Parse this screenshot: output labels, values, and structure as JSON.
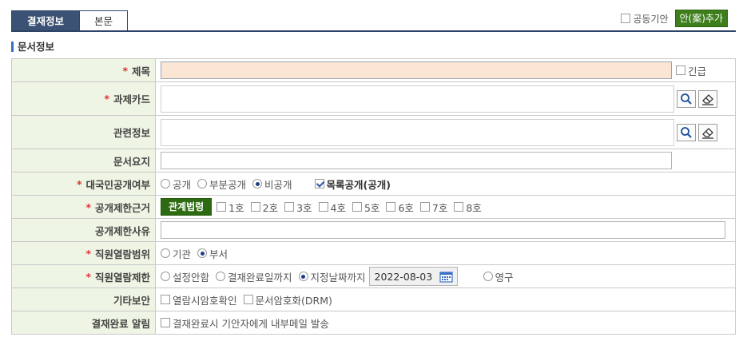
{
  "tabs": {
    "active": "결재정보",
    "inactive": "본문"
  },
  "top_right": {
    "joint_drafter_label": "공동기안",
    "add_draft_button": "안(案)추가"
  },
  "section_title": "문서정보",
  "rows": {
    "title": {
      "label": "제목",
      "urgent_label": "긴급"
    },
    "task_card": {
      "label": "과제카드"
    },
    "related_info": {
      "label": "관련정보"
    },
    "summary": {
      "label": "문서요지"
    },
    "public_status": {
      "label": "대국민공개여부",
      "options": [
        "공개",
        "부분공개",
        "비공개"
      ],
      "selected": "비공개",
      "list_public_label": "목록공개(공개)",
      "list_public_checked": true
    },
    "restriction_basis": {
      "label": "공개제한근거",
      "law_button": "관계법령",
      "items": [
        "1호",
        "2호",
        "3호",
        "4호",
        "5호",
        "6호",
        "7호",
        "8호"
      ]
    },
    "restriction_reason": {
      "label": "공개제한사유"
    },
    "viewing_scope": {
      "label": "직원열람범위",
      "options": [
        "기관",
        "부서"
      ],
      "selected": "부서"
    },
    "viewing_limit": {
      "label": "직원열람제한",
      "options": [
        "설정안함",
        "결재완료일까지",
        "지정날짜까지",
        "영구"
      ],
      "selected": "지정날짜까지",
      "date": "2022-08-03"
    },
    "other_security": {
      "label": "기타보안",
      "options": [
        "열람시암호확인",
        "문서암호화(DRM)"
      ]
    },
    "completion_alert": {
      "label": "결재완료 알림",
      "option": "결재완료시 기안자에게 내부메일 발송"
    }
  }
}
